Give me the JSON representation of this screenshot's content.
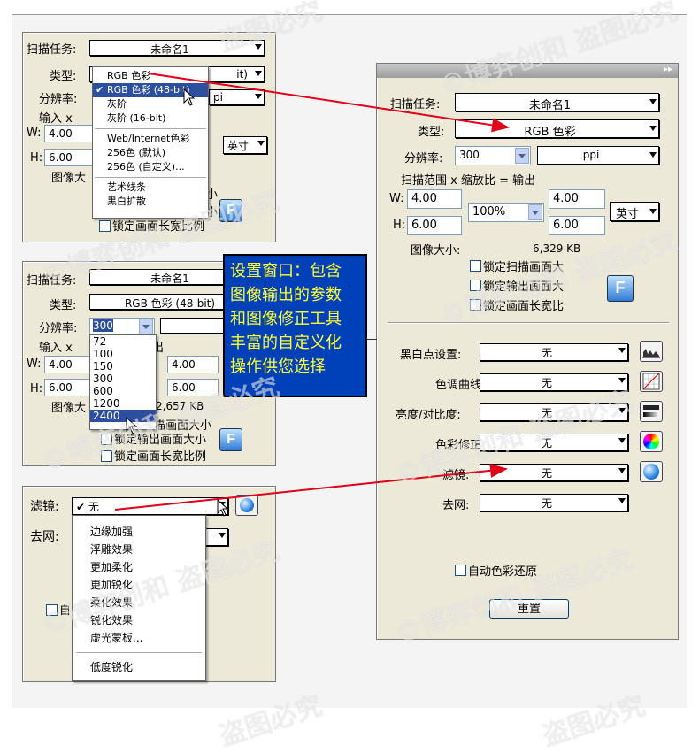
{
  "labels": {
    "scan_task": "扫描任务:",
    "type": "类型:",
    "resolution": "分辨率:",
    "input_x": "输入 x",
    "scan_range_header": "扫描范围 x 缩放比 = 输出",
    "w": "W:",
    "h": "H:",
    "image_size": "图像大小:",
    "out_partial": "出",
    "image_size_partial": "图像大",
    "filter": "滤镜:",
    "descreen": "去网:",
    "auto_color_restore": "自动色彩还原",
    "auto_partial": "自"
  },
  "values": {
    "task_name": "未命名1",
    "type_rgb": "RGB 色彩",
    "type_rgb48": "RGB 色彩 (48-bit)",
    "resolution": "300",
    "resolution_selected": "300",
    "unit_ppi": "ppi",
    "unit_ppi_partial": "pi",
    "w_in": "4.00",
    "h_in": "6.00",
    "w_out": "4.00",
    "h_out": "6.00",
    "scale": "100%",
    "inches": "英寸",
    "image_size": "6,329 KB",
    "image_size_2": "2,657 KB",
    "none": "无",
    "filter_none_checked": "✔ 无",
    "bit_partial": "it)",
    "f_button": "F",
    "reset_button": "重置"
  },
  "locks": {
    "scan": "锁定扫描画面大",
    "output": "锁定输出画面大",
    "ratio": "锁定画面长宽比",
    "ratio_full": "锁定画面长宽比例",
    "scan_partial": "描画面大小",
    "output_partial": "锁定输出画面大小",
    "small_partial_1": "小",
    "small_partial_2": "小"
  },
  "adjust": {
    "black_white_point": "黑白点设置:",
    "tone_curve": "色调曲线:",
    "brightness_contrast": "亮度/对比度:",
    "color_correction": "色彩修正:",
    "filter": "滤镜:",
    "descreen": "去网:"
  },
  "type_menu": {
    "items": [
      "RGB 色彩",
      "RGB 色彩 (48-bit)",
      "灰阶",
      "灰阶 (16-bit)",
      "Web/Internet色彩",
      "256色 (默认)",
      "256色 (自定义)...",
      "艺术线条",
      "黑白扩散"
    ]
  },
  "resolution_menu": {
    "items": [
      "72",
      "100",
      "150",
      "300",
      "600",
      "1200",
      "2400"
    ]
  },
  "filter_menu": {
    "items": [
      "边缘加强",
      "浮雕效果",
      "更加柔化",
      "更加锐化",
      "柔化效果",
      "锐化效果",
      "虚光蒙板...",
      "低度锐化"
    ]
  },
  "callout": {
    "lines": [
      "设置窗口：包含",
      "图像输出的参数",
      "和图像修正工具",
      "丰富的自定义化",
      "操作供您选择"
    ]
  },
  "watermark": {
    "text_1": "©博弈创和 盗图必究",
    "text_2": "盗图必究"
  },
  "colors": {
    "panel": "#ece9d8",
    "callout_bg": "#0040b8",
    "callout_text": "#ffff33",
    "arrow": "#e0001a",
    "menu_selected": "#2d4f9f"
  }
}
